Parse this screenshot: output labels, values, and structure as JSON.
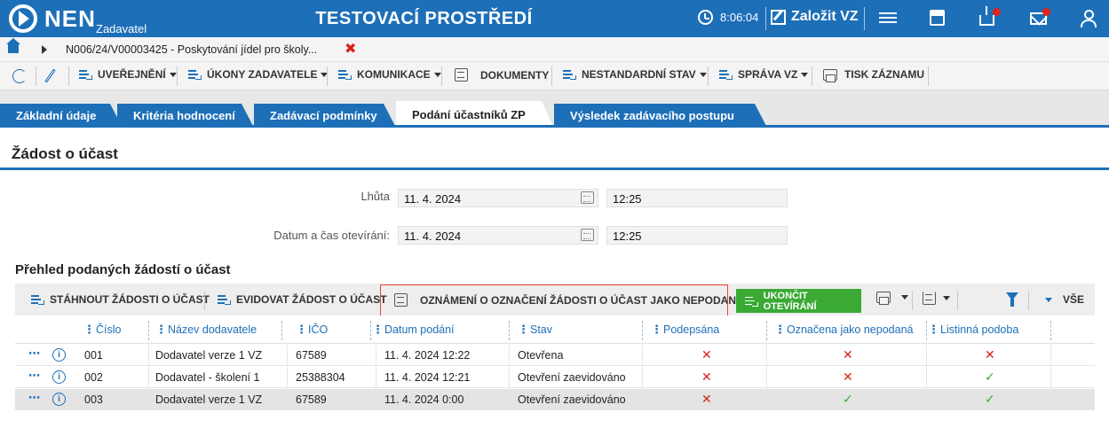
{
  "app": {
    "logo_text": "NEN",
    "logo_sub": "Zadavatel",
    "env_title": "TESTOVACÍ PROSTŘEDÍ",
    "clock": "8:06:04",
    "create_vz": "Založit VZ"
  },
  "breadcrumb": {
    "text": "N006/24/V00003425 - Poskytování jídel pro školy...",
    "close": "✖"
  },
  "toolbar": {
    "uverejneni": "UVEŘEJNĚNÍ",
    "ukony": "ÚKONY ZADAVATELE",
    "komunikace": "KOMUNIKACE",
    "dokumenty": "DOKUMENTY",
    "nestandardni": "NESTANDARDNÍ STAV",
    "sprava": "SPRÁVA VZ",
    "tisk": "TISK ZÁZNAMU"
  },
  "tabs": [
    {
      "label": "Základní údaje"
    },
    {
      "label": "Kritéria hodnocení"
    },
    {
      "label": "Zadávací podmínky"
    },
    {
      "label": "Podání účastníků ZP"
    },
    {
      "label": "Výsledek zadávacího postupu"
    }
  ],
  "section_title": "Žádost o účast",
  "form": {
    "lhuta_label": "Lhůta",
    "lhuta_date": "11. 4. 2024",
    "lhuta_time": "12:25",
    "otevirani_label": "Datum a čas otevírání:",
    "otevirani_date": "11. 4. 2024",
    "otevirani_time": "12:25"
  },
  "grid": {
    "title": "Přehled podaných žádostí o účast",
    "toolbar": {
      "stahnout": "STÁHNOUT ŽÁDOSTI O ÚČAST",
      "evidovat": "EVIDOVAT ŽÁDOST O ÚČAST",
      "oznameni": "OZNÁMENÍ O OZNAČENÍ ŽÁDOSTI O ÚČAST JAKO NEPODANÉ",
      "ukoncit": "UKONČIT OTEVÍRÁNÍ",
      "vse": "VŠE"
    },
    "columns": [
      "Číslo",
      "Název dodavatele",
      "IČO",
      "Datum podání",
      "Stav",
      "Podepsána",
      "Označena jako nepodaná",
      "Listinná podoba"
    ],
    "rows": [
      {
        "cislo": "001",
        "nazev": "Dodavatel verze 1 VZ",
        "ico": "67589",
        "datum": "11. 4. 2024 12:22",
        "stav": "Otevřena",
        "podepsana": "✕",
        "nepodana": "✕",
        "listinna": "✕"
      },
      {
        "cislo": "002",
        "nazev": "Dodavatel - školení 1",
        "ico": "25388304",
        "datum": "11. 4. 2024 12:21",
        "stav": "Otevření zaevidováno",
        "podepsana": "✕",
        "nepodana": "✕",
        "listinna": "✓"
      },
      {
        "cislo": "003",
        "nazev": "Dodavatel verze 1 VZ",
        "ico": "67589",
        "datum": "11. 4. 2024 0:00",
        "stav": "Otevření zaevidováno",
        "podepsana": "✕",
        "nepodana": "✓",
        "listinna": "✓"
      }
    ],
    "row_more": "⋯",
    "row_info": "i"
  },
  "colors": {
    "primary": "#1d6fb8",
    "success": "#3aaa35",
    "danger": "#d4231a"
  }
}
